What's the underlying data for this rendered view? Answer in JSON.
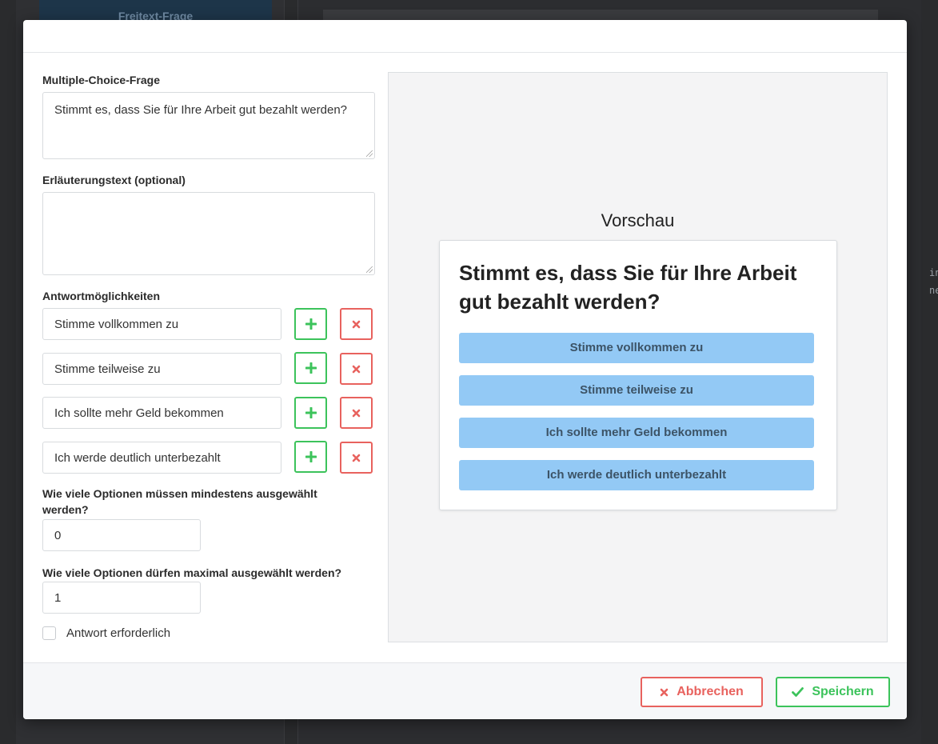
{
  "background": {
    "button_label": "Freitext-Frage",
    "side_text": [
      "in",
      "ne"
    ]
  },
  "form": {
    "question_label": "Multiple-Choice-Frage",
    "question_value": "Stimmt es, dass Sie für Ihre Arbeit gut bezahlt werden?",
    "explanation_label": "Erläuterungstext (optional)",
    "explanation_value": "",
    "answers_label": "Antwortmöglichkeiten",
    "answers": [
      "Stimme vollkommen zu",
      "Stimme teilweise zu",
      "Ich sollte mehr Geld bekommen",
      "Ich werde deutlich unterbezahlt"
    ],
    "min_label": "Wie viele Optionen müssen mindestens ausgewählt werden?",
    "min_value": "0",
    "max_label": "Wie viele Optionen dürfen maximal ausgewählt werden?",
    "max_value": "1",
    "required_label": "Antwort erforderlich",
    "required_checked": false
  },
  "preview": {
    "title": "Vorschau",
    "question": "Stimmt es, dass Sie für Ihre Arbeit gut bezahlt werden?",
    "options": [
      "Stimme vollkommen zu",
      "Stimme teilweise zu",
      "Ich sollte mehr Geld bekommen",
      "Ich werde deutlich unterbezahlt"
    ]
  },
  "footer": {
    "cancel_label": "Abbrechen",
    "save_label": "Speichern"
  },
  "colors": {
    "success": "#3cc35b",
    "danger": "#e8625e",
    "option_blue": "#93c9f5"
  },
  "icons": {
    "add": "plus-icon",
    "remove": "times-icon",
    "cancel": "times-icon",
    "save": "check-icon"
  }
}
